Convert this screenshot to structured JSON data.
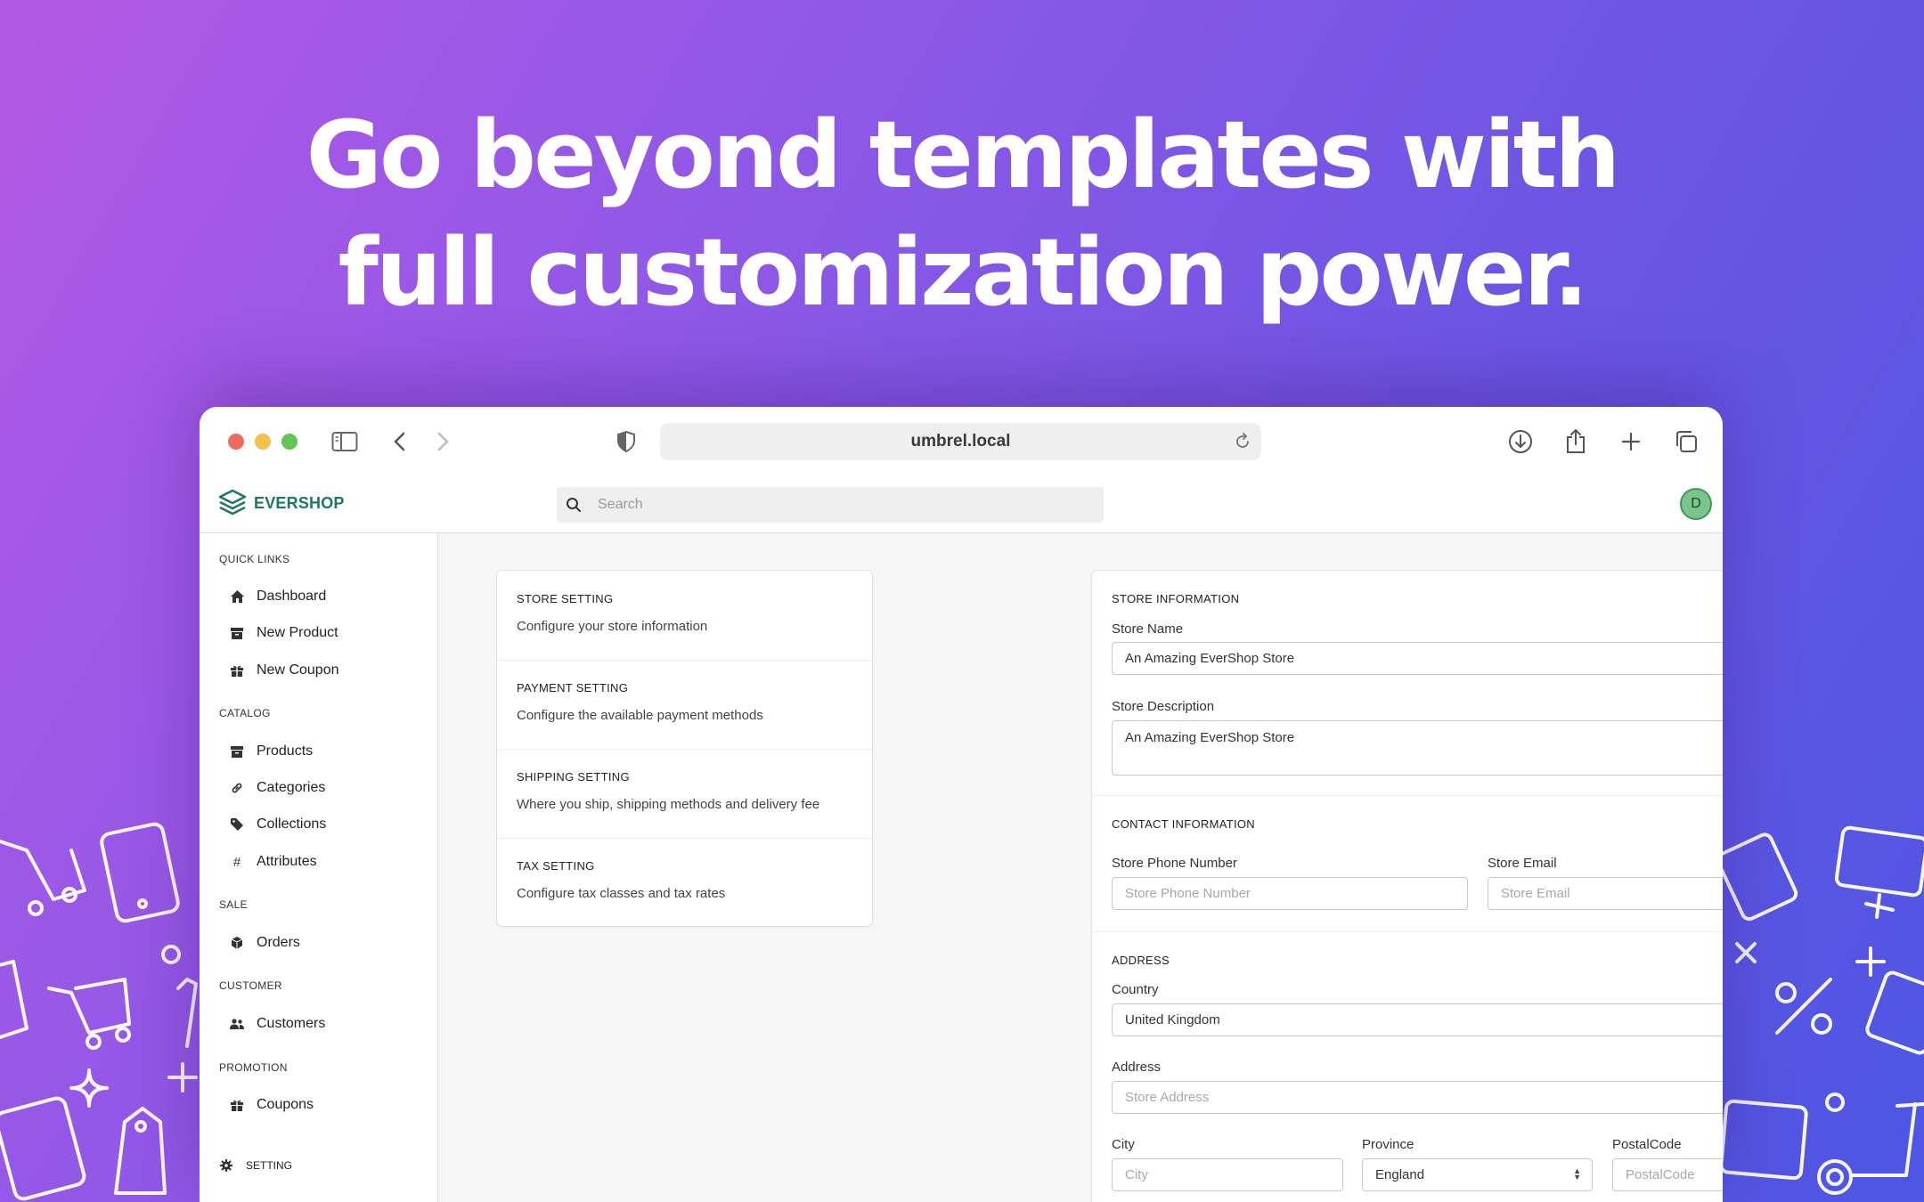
{
  "headline": {
    "line1": "Go beyond templates with",
    "line2": "full customization power."
  },
  "browser": {
    "url": "umbrel.local"
  },
  "app": {
    "logo_text": "EVERSHOP",
    "search_placeholder": "Search",
    "avatar_initial": "D"
  },
  "sidebar": {
    "sections": [
      {
        "title": "QUICK LINKS",
        "items": [
          {
            "label": "Dashboard",
            "icon": "home-icon"
          },
          {
            "label": "New Product",
            "icon": "archive-icon"
          },
          {
            "label": "New Coupon",
            "icon": "gift-icon"
          }
        ]
      },
      {
        "title": "CATALOG",
        "items": [
          {
            "label": "Products",
            "icon": "archive-icon"
          },
          {
            "label": "Categories",
            "icon": "link-icon"
          },
          {
            "label": "Collections",
            "icon": "tag-icon"
          },
          {
            "label": "Attributes",
            "icon": "hash-icon"
          }
        ]
      },
      {
        "title": "SALE",
        "items": [
          {
            "label": "Orders",
            "icon": "cube-icon"
          }
        ]
      },
      {
        "title": "CUSTOMER",
        "items": [
          {
            "label": "Customers",
            "icon": "users-icon"
          }
        ]
      },
      {
        "title": "PROMOTION",
        "items": [
          {
            "label": "Coupons",
            "icon": "gift-icon"
          }
        ]
      }
    ],
    "setting_label": "SETTING"
  },
  "settings_menu": [
    {
      "title": "STORE SETTING",
      "desc": "Configure your store information"
    },
    {
      "title": "PAYMENT SETTING",
      "desc": "Configure the available payment methods"
    },
    {
      "title": "SHIPPING SETTING",
      "desc": "Where you ship, shipping methods and delivery fee"
    },
    {
      "title": "TAX SETTING",
      "desc": "Configure tax classes and tax rates"
    }
  ],
  "form": {
    "store_info": {
      "title": "STORE INFORMATION",
      "name_label": "Store Name",
      "name_value": "An Amazing EverShop Store",
      "desc_label": "Store Description",
      "desc_value": "An Amazing EverShop Store"
    },
    "contact": {
      "title": "CONTACT INFORMATION",
      "phone_label": "Store Phone Number",
      "phone_placeholder": "Store Phone Number",
      "email_label": "Store Email",
      "email_placeholder": "Store Email"
    },
    "address": {
      "title": "ADDRESS",
      "country_label": "Country",
      "country_value": "United Kingdom",
      "address_label": "Address",
      "address_placeholder": "Store Address",
      "city_label": "City",
      "city_placeholder": "City",
      "province_label": "Province",
      "province_value": "England",
      "postal_label": "PostalCode",
      "postal_placeholder": "PostalCode"
    }
  },
  "colors": {
    "brand_green": "#1b7a5a",
    "accent_purple": "#8d58e6"
  }
}
